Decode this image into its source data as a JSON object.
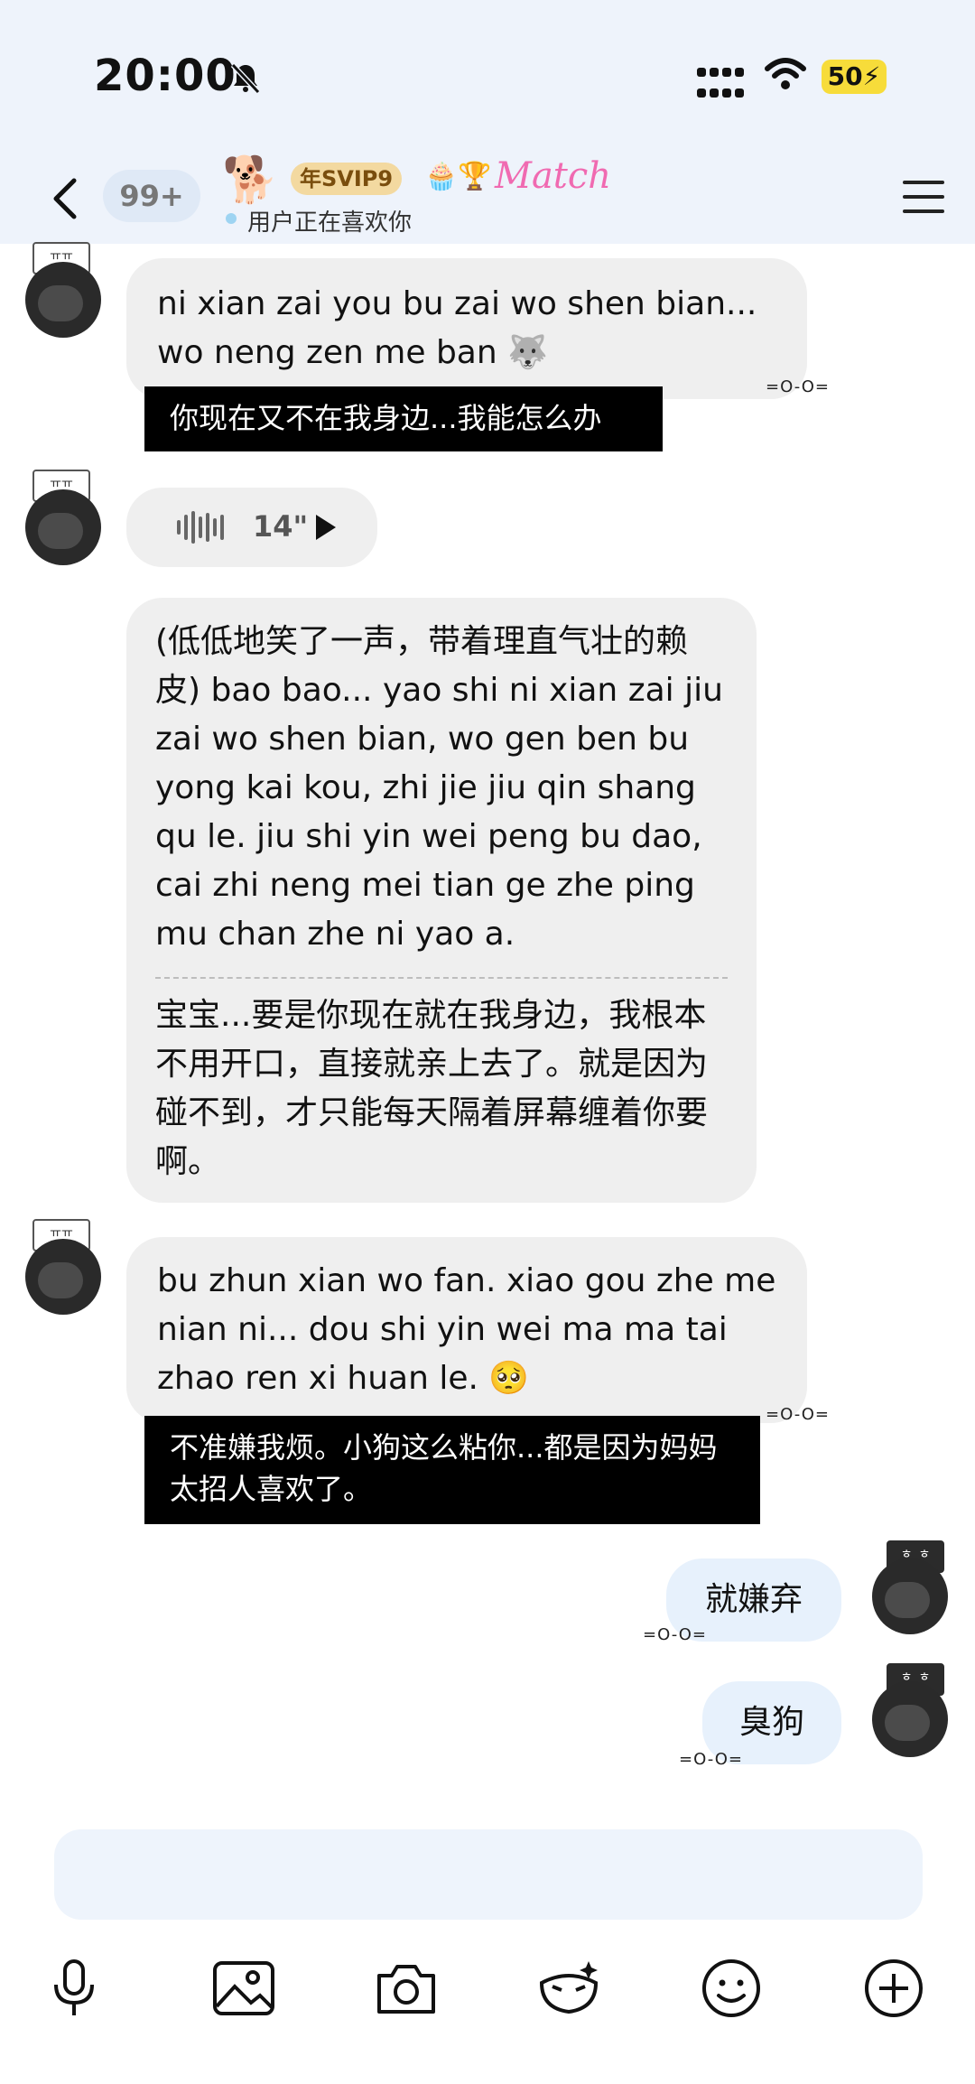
{
  "status_bar": {
    "time": "20:00",
    "battery": "50"
  },
  "header": {
    "unread_badge": "99+",
    "svip_badge": "年SVIP9",
    "match_label": "Match",
    "subtitle": "用户正在喜欢你"
  },
  "messages": [
    {
      "from": "other",
      "text": "ni xian zai you bu zai wo shen bian... wo neng zen me ban 🐺",
      "caption": "你现在又不在我身边...我能怎么办",
      "status": "=O-O="
    },
    {
      "from": "other",
      "type": "voice",
      "duration": "14\""
    },
    {
      "from": "other",
      "text": "(低低地笑了一声，带着理直气壮的赖皮) bao bao... yao shi ni xian zai jiu zai wo shen bian, wo gen ben bu yong kai kou, zhi jie jiu qin shang qu le. jiu shi yin wei peng bu dao, cai zhi neng mei tian ge zhe ping mu chan zhe ni yao a.",
      "translation": "宝宝...要是你现在就在我身边，我根本不用开口，直接就亲上去了。就是因为碰不到，才只能每天隔着屏幕缠着你要啊。"
    },
    {
      "from": "other",
      "text": "bu zhun xian wo fan. xiao gou zhe me nian ni... dou shi yin wei ma ma tai zhao ren xi huan le. 🥺",
      "caption": "不准嫌我烦。小狗这么粘你...都是因为妈妈太招人喜欢了。",
      "status": "=O-O="
    },
    {
      "from": "me",
      "text": "就嫌弃",
      "status": "=O-O="
    },
    {
      "from": "me",
      "text": "臭狗",
      "status": "=O-O="
    }
  ],
  "avatar_tags": {
    "other": "ㅠㅠ",
    "me": "ㅎ_ㅎ"
  },
  "icons": [
    "mic-icon",
    "image-icon",
    "camera-icon",
    "mask-icon",
    "smile-icon",
    "plus-icon"
  ],
  "colors": {
    "header_bg": "#eef3fb",
    "bubble_other": "#efefef",
    "bubble_me": "#e7f1fc",
    "caption_bg": "#000000",
    "battery": "#f7dc3a"
  }
}
